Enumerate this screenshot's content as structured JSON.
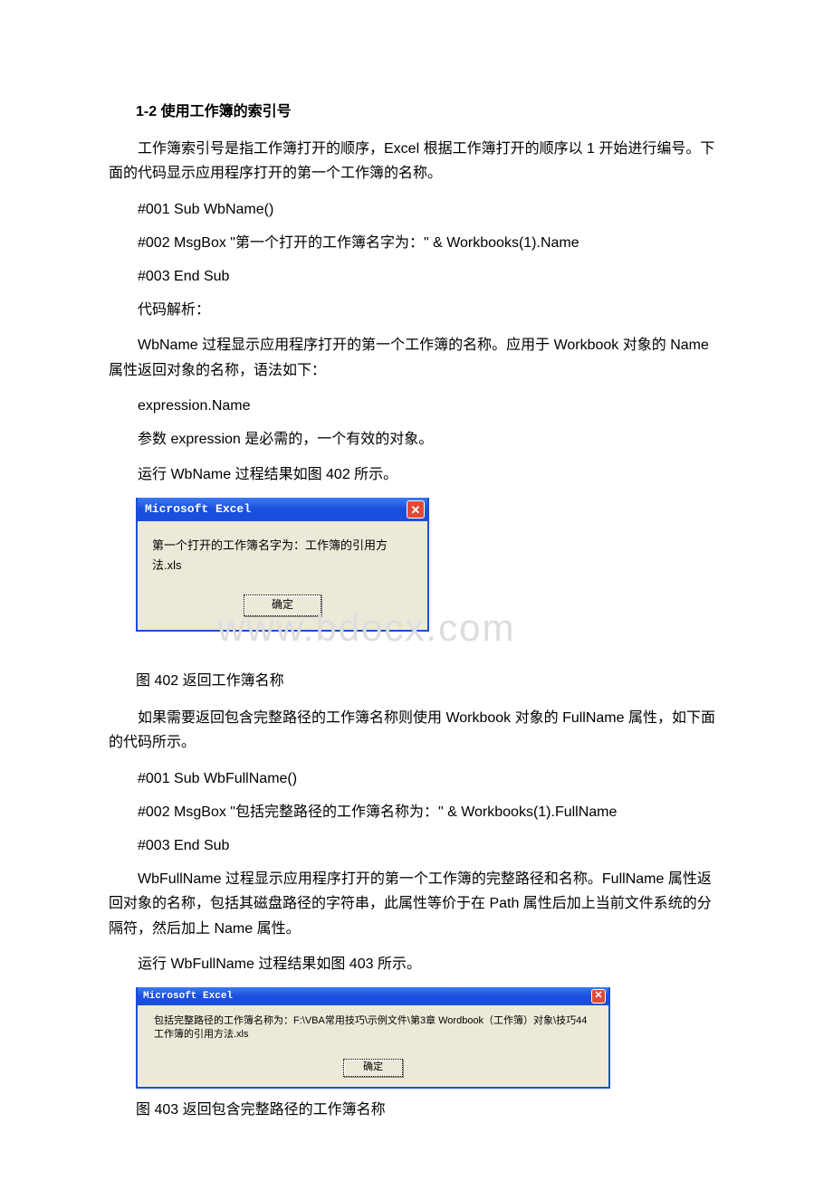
{
  "heading": "1-2 使用工作簿的索引号",
  "p1": "工作簿索引号是指工作簿打开的顺序，Excel 根据工作簿打开的顺序以 1 开始进行编号。下面的代码显示应用程序打开的第一个工作簿的名称。",
  "code1_l1": "#001 Sub WbName()",
  "code1_l2": "#002 MsgBox \"第一个打开的工作簿名字为：\" & Workbooks(1).Name",
  "code1_l3": "#003 End Sub",
  "analysis_label": "代码解析：",
  "p2": "WbName 过程显示应用程序打开的第一个工作簿的名称。应用于 Workbook 对象的 Name 属性返回对象的名称，语法如下：",
  "expr": "expression.Name",
  "p3": "参数 expression 是必需的，一个有效的对象。",
  "p4": "运行 WbName 过程结果如图 402 所示。",
  "dialog1": {
    "title": "Microsoft Excel",
    "close": "✕",
    "message": "第一个打开的工作簿名字为：工作簿的引用方法.xls",
    "ok": "确定"
  },
  "watermark": "www.bdocx.com",
  "cap1": "图 402 返回工作簿名称",
  "p5": "如果需要返回包含完整路径的工作簿名称则使用 Workbook 对象的 FullName 属性，如下面的代码所示。",
  "code2_l1": "#001 Sub WbFullName()",
  "code2_l2": "#002 MsgBox \"包括完整路径的工作簿名称为：\" & Workbooks(1).FullName",
  "code2_l3": "#003 End Sub",
  "p6": "WbFullName 过程显示应用程序打开的第一个工作簿的完整路径和名称。FullName 属性返回对象的名称，包括其磁盘路径的字符串，此属性等价于在 Path 属性后加上当前文件系统的分隔符，然后加上 Name 属性。",
  "p7": "运行 WbFullName 过程结果如图 403 所示。",
  "dialog2": {
    "title": "Microsoft Excel",
    "close": "✕",
    "message": "包括完整路径的工作簿名称为：F:\\VBA常用技巧\\示例文件\\第3章 Wordbook（工作簿）对象\\技巧44 工作簿的引用方法.xls",
    "ok": "确定"
  },
  "cap2": "图 403 返回包含完整路径的工作簿名称"
}
